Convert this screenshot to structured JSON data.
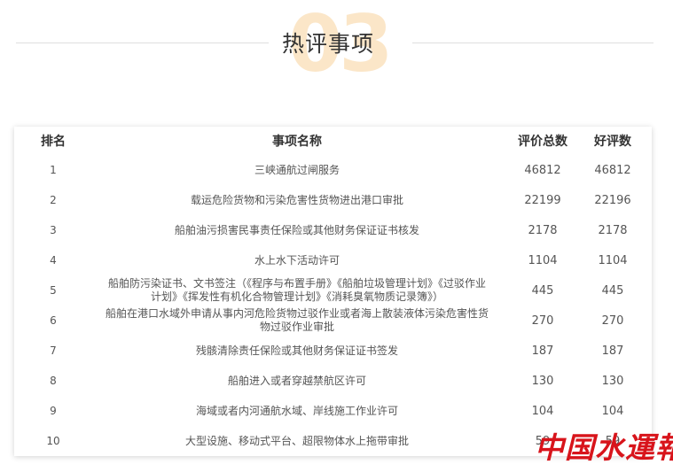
{
  "section": {
    "number": "03",
    "title": "热评事项"
  },
  "table": {
    "headers": {
      "rank": "排名",
      "name": "事项名称",
      "total": "评价总数",
      "good": "好评数"
    },
    "rows": [
      {
        "rank": "1",
        "name": "三峡通航过闸服务",
        "total": "46812",
        "good": "46812"
      },
      {
        "rank": "2",
        "name": "载运危险货物和污染危害性货物进出港口审批",
        "total": "22199",
        "good": "22196"
      },
      {
        "rank": "3",
        "name": "船舶油污损害民事责任保险或其他财务保证证书核发",
        "total": "2178",
        "good": "2178"
      },
      {
        "rank": "4",
        "name": "水上水下活动许可",
        "total": "1104",
        "good": "1104"
      },
      {
        "rank": "5",
        "name": "船舶防污染证书、文书签注（《程序与布置手册》《船舶垃圾管理计划》《过驳作业计划》《挥发性有机化合物管理计划》《消耗臭氧物质记录簿》）",
        "total": "445",
        "good": "445"
      },
      {
        "rank": "6",
        "name": "船舶在港口水域外申请从事内河危险货物过驳作业或者海上散装液体污染危害性货物过驳作业审批",
        "total": "270",
        "good": "270"
      },
      {
        "rank": "7",
        "name": "残骸清除责任保险或其他财务保证证书签发",
        "total": "187",
        "good": "187"
      },
      {
        "rank": "8",
        "name": "船舶进入或者穿越禁航区许可",
        "total": "130",
        "good": "130"
      },
      {
        "rank": "9",
        "name": "海域或者内河通航水域、岸线施工作业许可",
        "total": "104",
        "good": "104"
      },
      {
        "rank": "10",
        "name": "大型设施、移动式平台、超限物体水上拖带审批",
        "total": "59",
        "good": "59"
      }
    ]
  },
  "watermark": {
    "text": "中国水運報"
  }
}
